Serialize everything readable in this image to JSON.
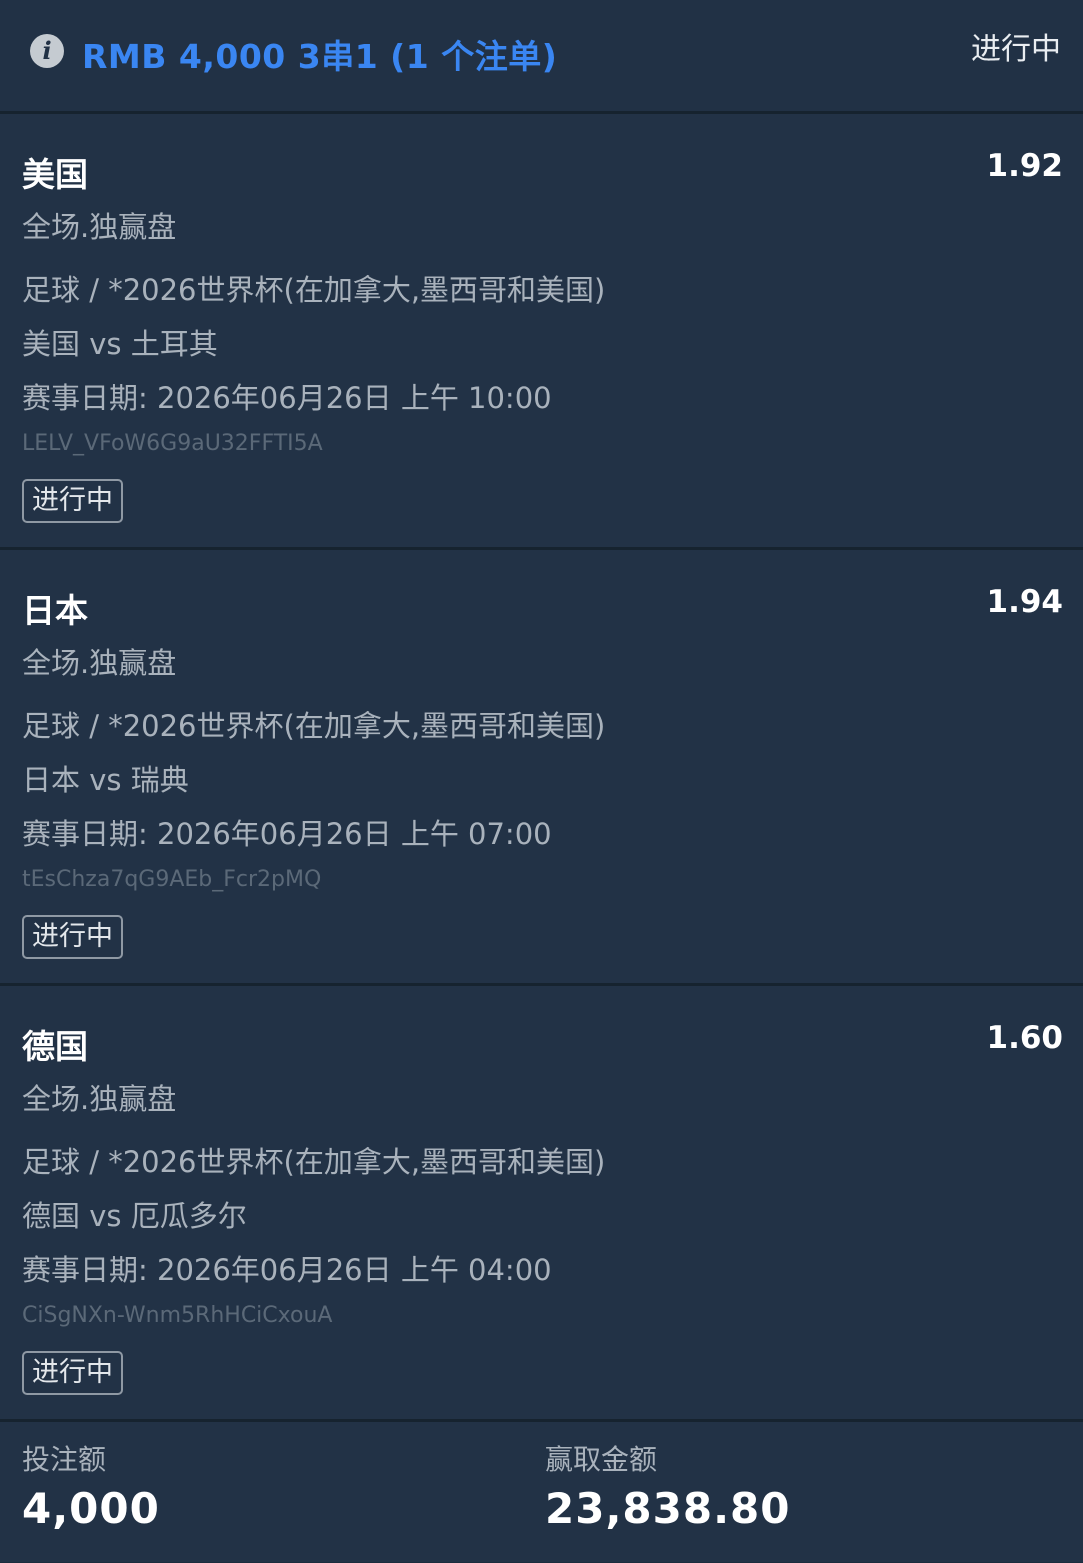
{
  "header": {
    "title": "RMB 4,000 3串1 (1 个注单)",
    "status": "进行中"
  },
  "legs": [
    {
      "team": "美国",
      "odds": "1.92",
      "market": "全场.独赢盘",
      "league": "足球 / *2026世界杯(在加拿大,墨西哥和美国)",
      "match": "美国 vs 土耳其",
      "date": "赛事日期: 2026年06月26日 上午 10:00",
      "code": "LELV_VFoW6G9aU32FFTI5A",
      "status": "进行中"
    },
    {
      "team": "日本",
      "odds": "1.94",
      "market": "全场.独赢盘",
      "league": "足球 / *2026世界杯(在加拿大,墨西哥和美国)",
      "match": "日本 vs 瑞典",
      "date": "赛事日期: 2026年06月26日 上午 07:00",
      "code": "tEsChza7qG9AEb_Fcr2pMQ",
      "status": "进行中"
    },
    {
      "team": "德国",
      "odds": "1.60",
      "market": "全场.独赢盘",
      "league": "足球 / *2026世界杯(在加拿大,墨西哥和美国)",
      "match": "德国 vs 厄瓜多尔",
      "date": "赛事日期: 2026年06月26日 上午 04:00",
      "code": "CiSgNXn-Wnm5RhHCiCxouA",
      "status": "进行中"
    }
  ],
  "summary": {
    "stake_label": "投注额",
    "stake_value": "4,000",
    "payout_label": "赢取金额",
    "payout_value": "23,838.80"
  },
  "colors": {
    "background": "#1a2c3d",
    "card": "#223246",
    "accent": "#3a86f2",
    "text_primary": "#ffffff",
    "text_secondary": "#a9b2bc",
    "text_muted": "#5b6978"
  },
  "icons": {
    "header": "info-icon"
  }
}
